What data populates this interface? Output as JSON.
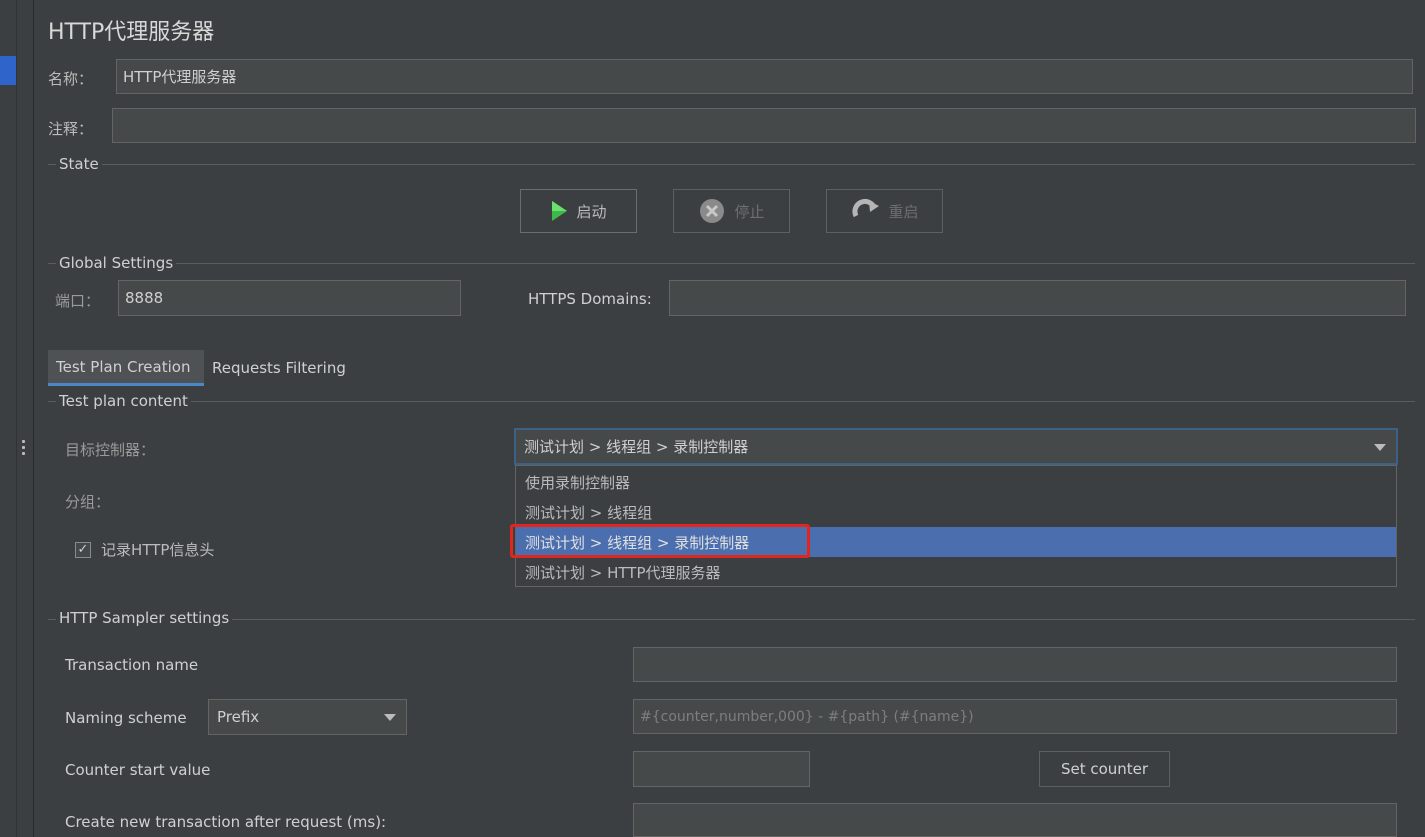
{
  "panel": {
    "title": "HTTP代理服务器",
    "name_label": "名称：",
    "name_value": "HTTP代理服务器",
    "comment_label": "注释：",
    "comment_value": ""
  },
  "state": {
    "legend": "State",
    "start_label": "启动",
    "stop_label": "停止",
    "restart_label": "重启"
  },
  "global": {
    "legend": "Global Settings",
    "port_label": "端口：",
    "port_value": "8888",
    "https_label": "HTTPS Domains:",
    "https_value": ""
  },
  "tabs": [
    {
      "label": "Test Plan Creation",
      "active": true
    },
    {
      "label": "Requests Filtering",
      "active": false
    }
  ],
  "plan": {
    "legend": "Test plan content",
    "target_label": "目标控制器：",
    "target_value": "测试计划 > 线程组 > 录制控制器",
    "group_label": "分组：",
    "record_headers_label": "记录HTTP信息头",
    "record_headers_checked": true,
    "options": [
      "使用录制控制器",
      "测试计划 > 线程组",
      "测试计划 > 线程组 > 录制控制器",
      "测试计划 > HTTP代理服务器"
    ],
    "selected_index": 2
  },
  "sampler": {
    "legend": "HTTP Sampler settings",
    "transaction_label": "Transaction name",
    "transaction_value": "",
    "naming_label": "Naming scheme",
    "naming_value": "Prefix",
    "naming_format": "#{counter,number,000} - #{path} (#{name})",
    "counter_label": "Counter start value",
    "counter_value": "",
    "set_counter_label": "Set counter",
    "new_txn_label": "Create new transaction after request (ms):",
    "new_txn_value": ""
  },
  "colors": {
    "background": "#3c3f41",
    "selection": "#4b6eaf",
    "highlight_box": "#e0261f",
    "tab_underline": "#4a88c7"
  }
}
